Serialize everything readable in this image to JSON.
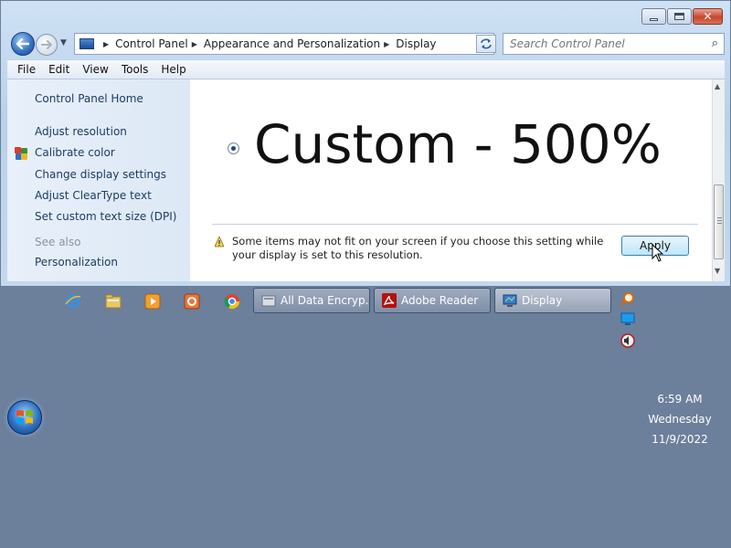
{
  "window": {
    "caption_buttons": {
      "minimize_icon": "minimize-icon",
      "maximize_icon": "maximize-icon",
      "close_glyph": "✕"
    },
    "nav": {
      "back_icon": "back-arrow-icon",
      "forward_icon": "forward-arrow-icon",
      "history_icon": "chevron-down-icon",
      "refresh_icon": "refresh-icon"
    },
    "breadcrumb": [
      "Control Panel",
      "Appearance and Personalization",
      "Display"
    ],
    "search": {
      "placeholder": "Search Control Panel",
      "icon": "search-icon"
    },
    "menu": [
      "File",
      "Edit",
      "View",
      "Tools",
      "Help"
    ]
  },
  "sidebar": {
    "home": "Control Panel Home",
    "links": [
      "Adjust resolution",
      "Calibrate color",
      "Change display settings",
      "Adjust ClearType text",
      "Set custom text size (DPI)"
    ],
    "see_also": "See also",
    "see_also_items": [
      "Personalization"
    ]
  },
  "main": {
    "option_label": "Custom - 500%",
    "option_selected": true,
    "warning_text": "Some items may not fit on your screen if you choose this setting while your display is set to this resolution.",
    "apply_label": "Apply"
  },
  "taskbar": {
    "quick_launch": [
      "internet-explorer-icon",
      "folder-icon",
      "media-player-icon",
      "app-icon",
      "chrome-icon"
    ],
    "tasks": [
      {
        "label": "All Data Encryp...",
        "icon": "encryption-app-icon",
        "active": false
      },
      {
        "label": "Adobe Reader",
        "icon": "adobe-reader-icon",
        "active": false
      },
      {
        "label": "Display",
        "icon": "display-icon",
        "active": true
      }
    ],
    "tray": [
      "magnifier-icon",
      "network-monitor-icon",
      "volume-icon"
    ]
  },
  "clock": {
    "time": "6:59 AM",
    "day": "Wednesday",
    "date": "11/9/2022"
  },
  "colors": {
    "accent": "#2f6fc2",
    "taskbar": "#6c7f9b",
    "link": "#1e3b63"
  }
}
